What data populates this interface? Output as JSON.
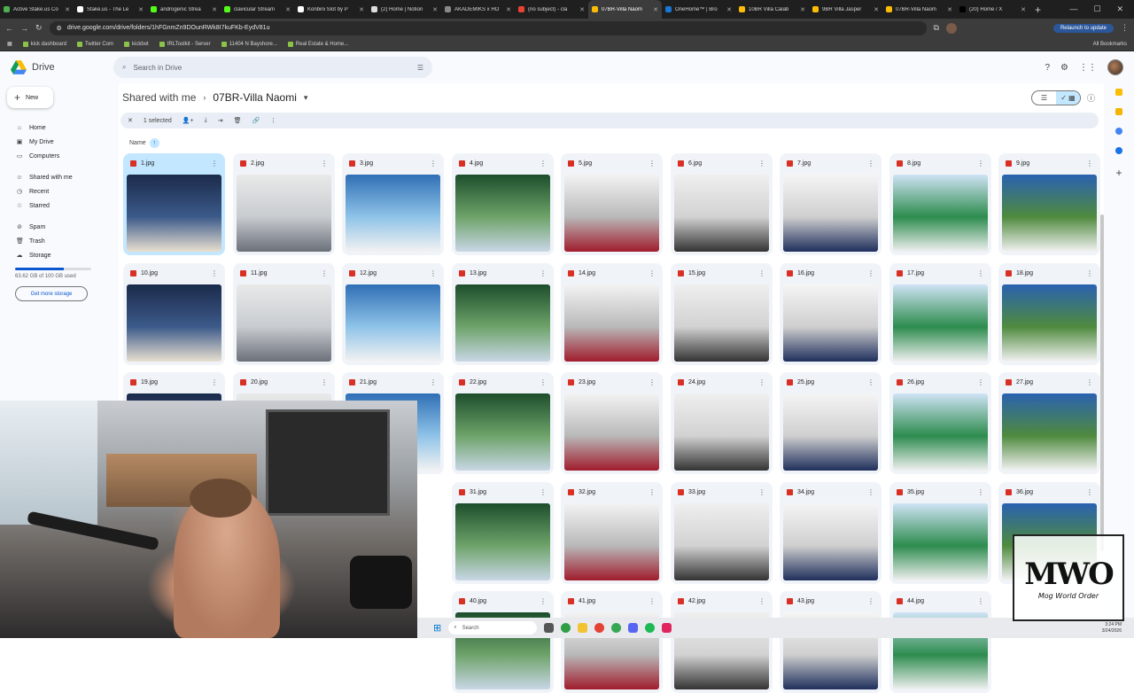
{
  "browser": {
    "tabs": [
      {
        "label": "Active Stake.us Co",
        "fav": "#4caf50"
      },
      {
        "label": "Stake.us - The Le",
        "fav": "#ffffff"
      },
      {
        "label": "androgenic Strea",
        "fav": "#53fc18"
      },
      {
        "label": "clavicular Stream",
        "fav": "#53fc18"
      },
      {
        "label": "Konbini Slot by P",
        "fav": "#ffffff"
      },
      {
        "label": "(2) Home | Notion",
        "fav": "#dddddd"
      },
      {
        "label": "AKADEMIKS x HO",
        "fav": "#888888"
      },
      {
        "label": "(no subject) - cla",
        "fav": "#ea4335"
      },
      {
        "label": "07BR-Villa Naom",
        "fav": "#fbbc04",
        "active": true
      },
      {
        "label": "OneHome™ | Bro",
        "fav": "#1976d2"
      },
      {
        "label": "10BR Villa Calab",
        "fav": "#fbbc04"
      },
      {
        "label": "9BR Villa Jasper",
        "fav": "#fbbc04"
      },
      {
        "label": "07BR-Villa Naom",
        "fav": "#fbbc04"
      },
      {
        "label": "(20) Home / X",
        "fav": "#000000"
      }
    ],
    "url": "drive.google.com/drive/folders/1hFGnmZn9DOunRWk8I7kuFKb-EydV81u",
    "relaunch": "Relaunch to update",
    "bookmarks": [
      "kick dashboard",
      "Twitter Com",
      "kickbot",
      "IRLToolkit - Server",
      "11404 N Bayshore...",
      "Real Estate & Home..."
    ],
    "all_bookmarks": "All Bookmarks"
  },
  "drive": {
    "app_name": "Drive",
    "search_placeholder": "Search in Drive",
    "new_label": "New",
    "nav": [
      {
        "label": "Home",
        "icon": "home-icon",
        "glyph": "⌂"
      },
      {
        "label": "My Drive",
        "icon": "my-drive-icon",
        "glyph": "▣"
      },
      {
        "label": "Computers",
        "icon": "computer-icon",
        "glyph": "▭"
      },
      {
        "label": "",
        "gap": true
      },
      {
        "label": "Shared with me",
        "icon": "people-icon",
        "glyph": "☺"
      },
      {
        "label": "Recent",
        "icon": "clock-icon",
        "glyph": "◷"
      },
      {
        "label": "Starred",
        "icon": "star-icon",
        "glyph": "☆"
      },
      {
        "label": "",
        "gap": true
      },
      {
        "label": "Spam",
        "icon": "spam-icon",
        "glyph": "⊘"
      },
      {
        "label": "Trash",
        "icon": "trash-icon",
        "glyph": "🗑"
      },
      {
        "label": "Storage",
        "icon": "cloud-icon",
        "glyph": "☁"
      }
    ],
    "storage_used": "63.62 GB of 100 GB used",
    "storage_fraction": 0.636,
    "get_more_storage": "Get more storage",
    "breadcrumb": {
      "parent": "Shared with me",
      "current": "07BR-Villa Naomi"
    },
    "selection": {
      "count_label": "1 selected"
    },
    "sort_label": "Name",
    "files": [
      "1.jpg",
      "2.jpg",
      "3.jpg",
      "4.jpg",
      "5.jpg",
      "6.jpg",
      "7.jpg",
      "8.jpg",
      "9.jpg",
      "10.jpg",
      "11.jpg",
      "12.jpg",
      "13.jpg",
      "14.jpg",
      "15.jpg",
      "16.jpg",
      "17.jpg",
      "18.jpg",
      "19.jpg",
      "20.jpg",
      "21.jpg",
      "22.jpg",
      "23.jpg",
      "24.jpg",
      "25.jpg",
      "26.jpg",
      "27.jpg",
      "",
      "",
      "",
      "31.jpg",
      "32.jpg",
      "33.jpg",
      "34.jpg",
      "35.jpg",
      "36.jpg",
      "",
      "",
      "",
      "40.jpg",
      "41.jpg",
      "42.jpg",
      "43.jpg",
      "44.jpg",
      ""
    ],
    "selected_file": "1.jpg"
  },
  "taskbar": {
    "search_placeholder": "Search",
    "time": "3:24 PM",
    "date": "3/24/2026"
  },
  "watermark": {
    "mark": "MWO",
    "text": "Mog World Order"
  }
}
